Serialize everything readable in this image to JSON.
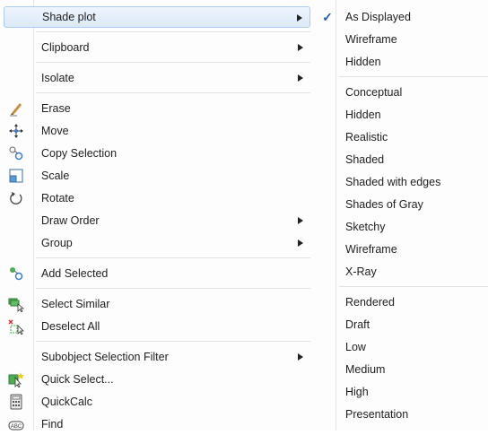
{
  "main_menu": {
    "items": [
      {
        "label": "Shade plot",
        "icon": "",
        "submenu": true
      },
      {
        "label": "Clipboard",
        "icon": "",
        "submenu": true
      },
      {
        "label": "Isolate",
        "icon": "",
        "submenu": true
      },
      {
        "label": "Erase",
        "icon": "eraser-icon",
        "submenu": false
      },
      {
        "label": "Move",
        "icon": "move-icon",
        "submenu": false
      },
      {
        "label": "Copy Selection",
        "icon": "copy-icon",
        "submenu": false
      },
      {
        "label": "Scale",
        "icon": "scale-icon",
        "submenu": false
      },
      {
        "label": "Rotate",
        "icon": "rotate-icon",
        "submenu": false
      },
      {
        "label": "Draw Order",
        "icon": "",
        "submenu": true
      },
      {
        "label": "Group",
        "icon": "",
        "submenu": true
      },
      {
        "label": "Add Selected",
        "icon": "add-selected-icon",
        "submenu": false
      },
      {
        "label": "Select Similar",
        "icon": "select-similar-icon",
        "submenu": false
      },
      {
        "label": "Deselect All",
        "icon": "deselect-all-icon",
        "submenu": false
      },
      {
        "label": "Subobject Selection Filter",
        "icon": "",
        "submenu": true
      },
      {
        "label": "Quick Select...",
        "icon": "quick-select-icon",
        "submenu": false
      },
      {
        "label": "QuickCalc",
        "icon": "calculator-icon",
        "submenu": false
      },
      {
        "label": "Find",
        "icon": "find-icon",
        "submenu": false
      }
    ],
    "arrow_glyph": "▶"
  },
  "sub_menu": {
    "check_glyph": "✓",
    "items": [
      {
        "label": "As Displayed",
        "checked": true
      },
      {
        "label": "Wireframe",
        "checked": false
      },
      {
        "label": "Hidden",
        "checked": false
      },
      {
        "label": "Conceptual",
        "checked": false
      },
      {
        "label": "Hidden",
        "checked": false
      },
      {
        "label": "Realistic",
        "checked": false
      },
      {
        "label": "Shaded",
        "checked": false
      },
      {
        "label": "Shaded with edges",
        "checked": false
      },
      {
        "label": "Shades of Gray",
        "checked": false
      },
      {
        "label": "Sketchy",
        "checked": false
      },
      {
        "label": "Wireframe",
        "checked": false
      },
      {
        "label": "X-Ray",
        "checked": false
      },
      {
        "label": "Rendered",
        "checked": false
      },
      {
        "label": "Draft",
        "checked": false
      },
      {
        "label": "Low",
        "checked": false
      },
      {
        "label": "Medium",
        "checked": false
      },
      {
        "label": "High",
        "checked": false
      },
      {
        "label": "Presentation",
        "checked": false
      }
    ]
  },
  "colors": {
    "highlight": "#dce9f8",
    "highlight_border": "#aecbf0",
    "check": "#1e5fb4"
  }
}
